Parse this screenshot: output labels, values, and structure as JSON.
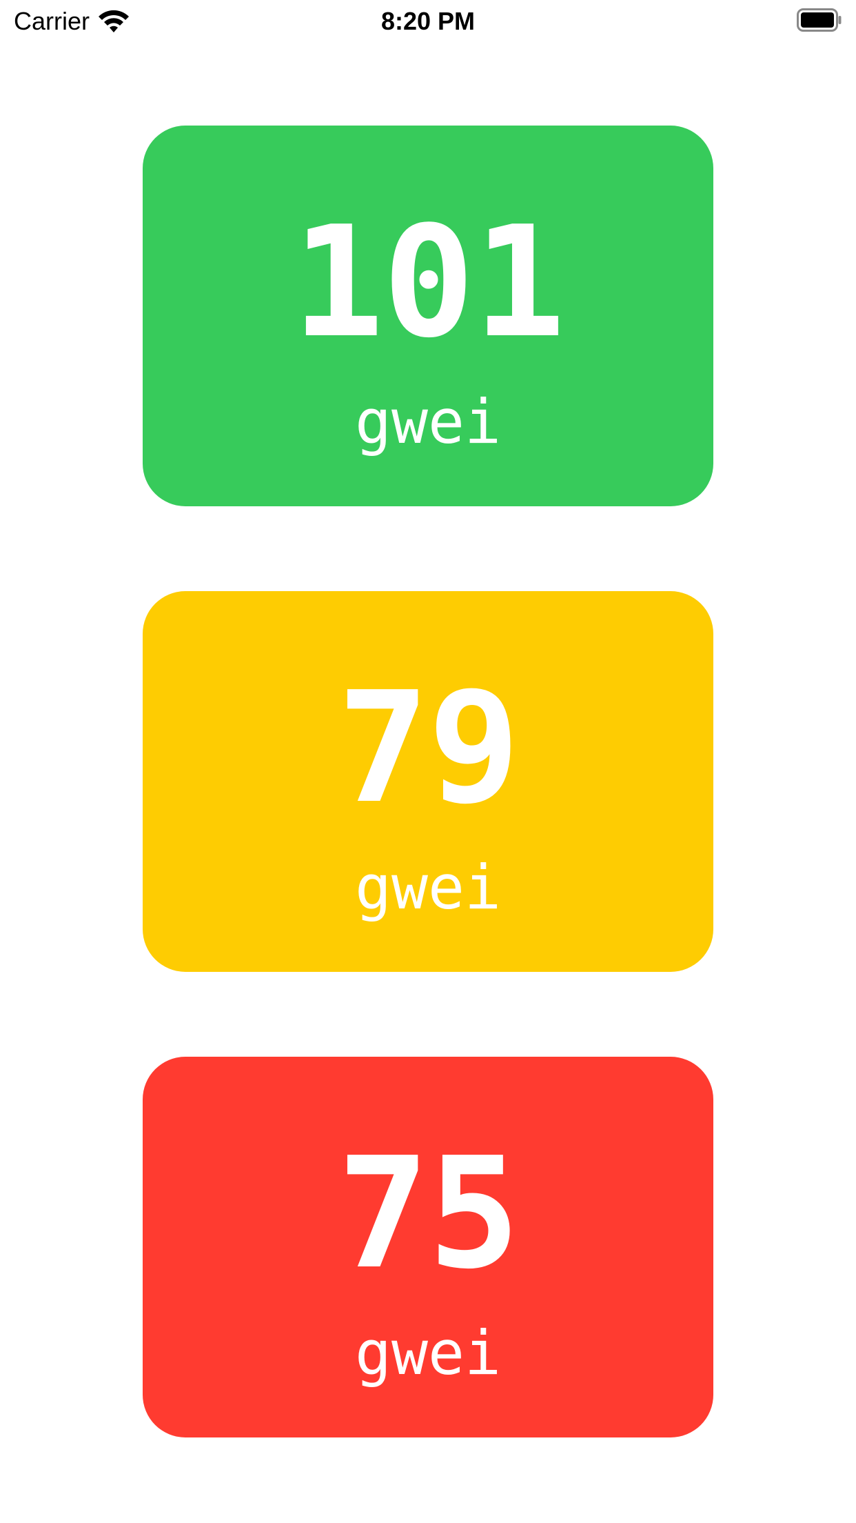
{
  "status_bar": {
    "carrier": "Carrier",
    "time": "8:20 PM",
    "wifi_icon": "wifi-icon",
    "battery_icon": "battery-icon"
  },
  "cards": [
    {
      "value": "101",
      "unit": "gwei",
      "color": "#37cb5b"
    },
    {
      "value": "79",
      "unit": "gwei",
      "color": "#fecc02"
    },
    {
      "value": "75",
      "unit": "gwei",
      "color": "#ff3b30"
    }
  ]
}
